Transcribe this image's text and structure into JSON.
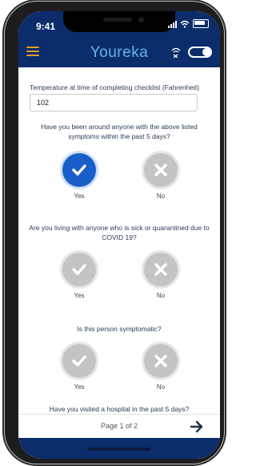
{
  "status_bar": {
    "time": "9:41"
  },
  "app": {
    "title": "Youreka",
    "brand_color": "#0c2d6b",
    "title_color": "#5fb7e8",
    "menu_color": "#e89a2a",
    "selected_color": "#1a5fc9"
  },
  "form": {
    "temperature": {
      "label": "Temperature at time of completing checklist (Fahrenheit)",
      "value": "102"
    },
    "questions": [
      {
        "text": "Have you been around anyone with the above listed symptoms within the past 5 days?",
        "yes_label": "Yes",
        "no_label": "No",
        "selected": "yes"
      },
      {
        "text": "Are you living with anyone who is sick or quarantined due to COVID 19?",
        "yes_label": "Yes",
        "no_label": "No",
        "selected": "none"
      },
      {
        "text": "Is this person symptomatic?",
        "yes_label": "Yes",
        "no_label": "No",
        "selected": "none"
      },
      {
        "text": "Have you visited a hospital in the past 5 days?"
      }
    ]
  },
  "footer": {
    "page_label": "Page 1 of 2",
    "next_icon": "arrow-right-icon"
  }
}
